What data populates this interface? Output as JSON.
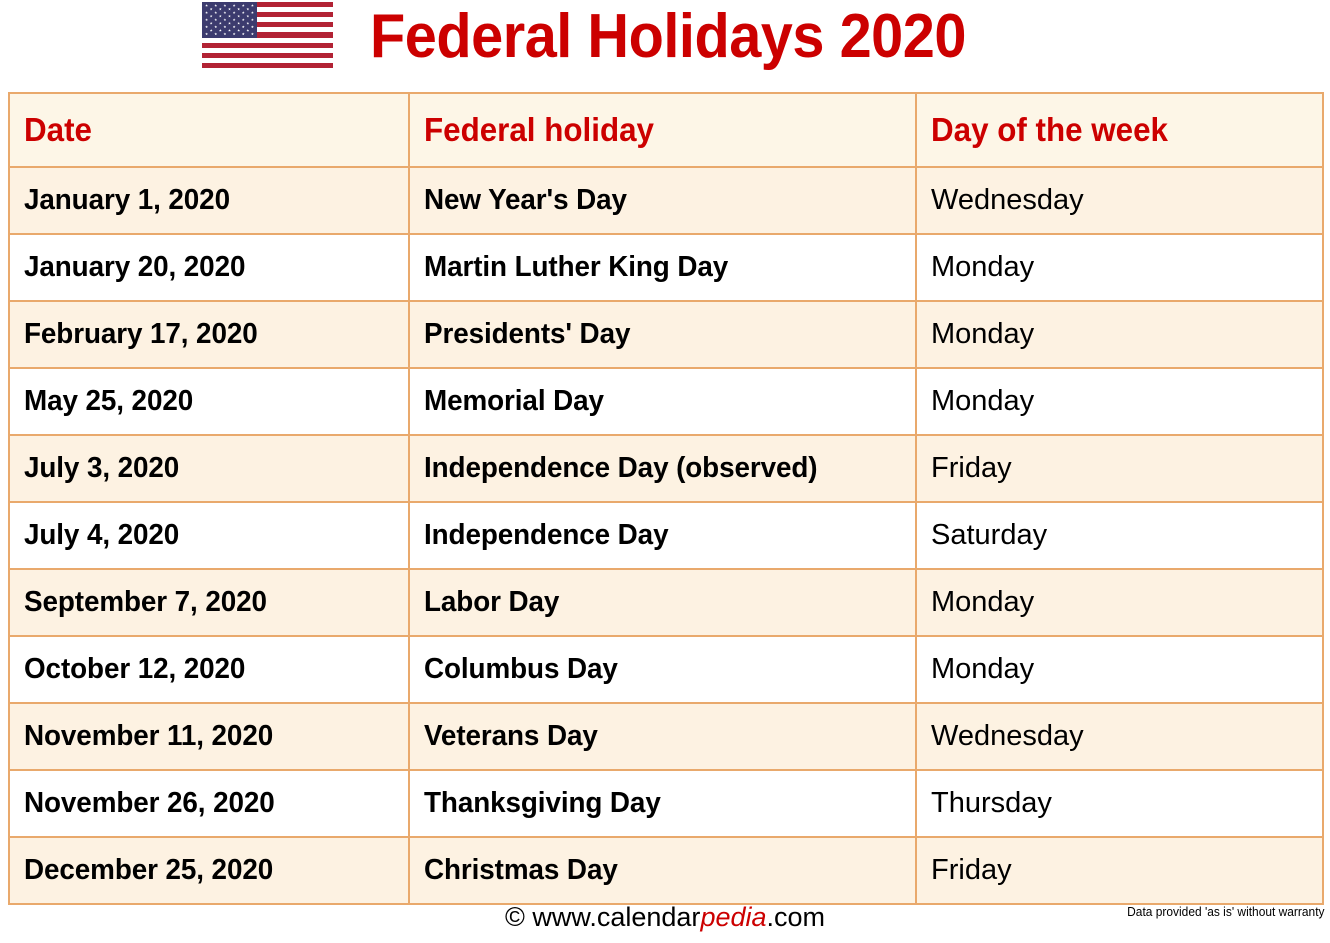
{
  "header": {
    "title": "Federal Holidays 2020",
    "flag_icon": "us-flag-icon",
    "title_color": "#cc0000"
  },
  "table": {
    "columns": [
      "Date",
      "Federal holiday",
      "Day of the week"
    ],
    "header_text_color": "#cc0000",
    "header_bg": "#fdf6e7",
    "border_color": "#e9a96c",
    "row_alt_bg": "#fdf2e2",
    "rows": [
      {
        "date": "January 1, 2020",
        "holiday": "New Year's Day",
        "dow": "Wednesday"
      },
      {
        "date": "January 20, 2020",
        "holiday": "Martin Luther King Day",
        "dow": "Monday"
      },
      {
        "date": "February 17, 2020",
        "holiday": "Presidents' Day",
        "dow": "Monday"
      },
      {
        "date": "May 25, 2020",
        "holiday": "Memorial Day",
        "dow": "Monday"
      },
      {
        "date": "July 3, 2020",
        "holiday": "Independence Day (observed)",
        "dow": "Friday"
      },
      {
        "date": "July 4, 2020",
        "holiday": "Independence Day",
        "dow": "Saturday"
      },
      {
        "date": "September 7, 2020",
        "holiday": "Labor Day",
        "dow": "Monday"
      },
      {
        "date": "October 12, 2020",
        "holiday": "Columbus Day",
        "dow": "Monday"
      },
      {
        "date": "November 11, 2020",
        "holiday": "Veterans Day",
        "dow": "Wednesday"
      },
      {
        "date": "November 26, 2020",
        "holiday": "Thanksgiving Day",
        "dow": "Thursday"
      },
      {
        "date": "December 25, 2020",
        "holiday": "Christmas Day",
        "dow": "Friday"
      }
    ]
  },
  "footer": {
    "credit_prefix": "© www.calendar",
    "credit_brand": "pedia",
    "credit_suffix": ".com",
    "disclaimer": "Data provided 'as is' without warranty"
  }
}
